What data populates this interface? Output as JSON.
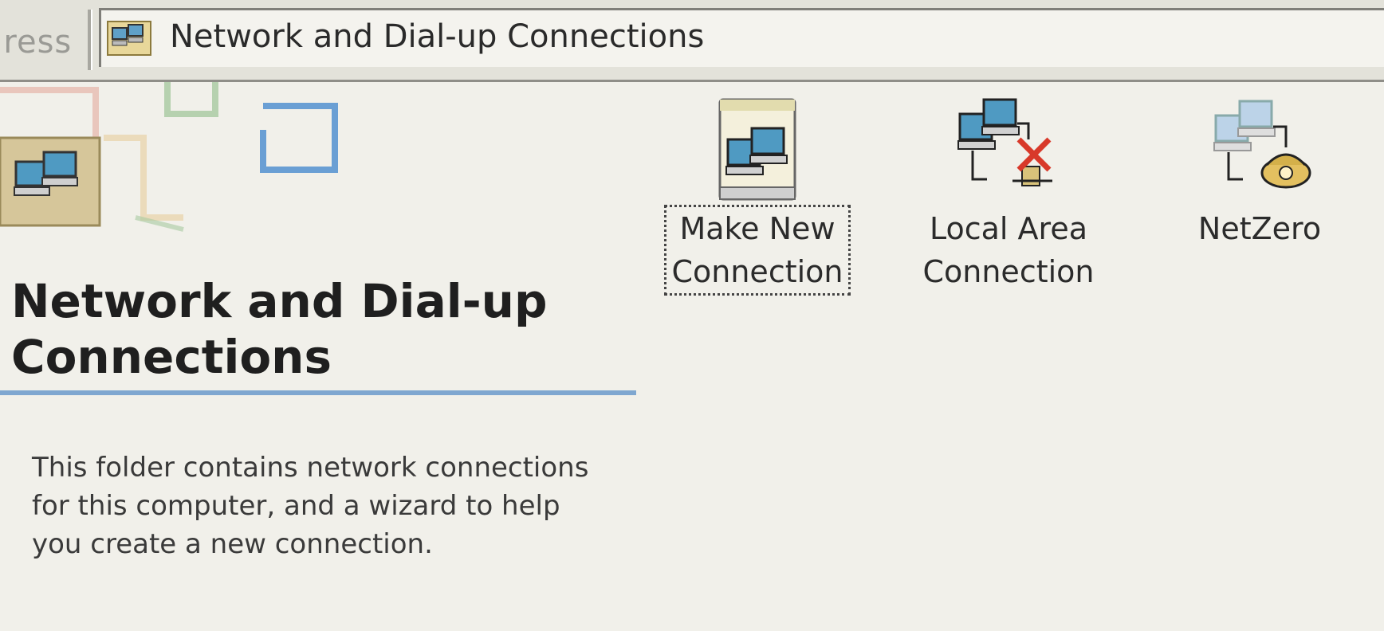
{
  "address_bar": {
    "label": "dress",
    "path": "Network and Dial-up Connections"
  },
  "left_panel": {
    "title": "Network and Dial-up Connections",
    "description": "This folder contains network connections for this computer, and a wizard to help you create a new connection."
  },
  "items": [
    {
      "label_line1": "Make New",
      "label_line2": "Connection",
      "icon": "make-new-connection-icon",
      "selected": true
    },
    {
      "label_line1": "Local Area",
      "label_line2": "Connection",
      "icon": "local-area-connection-disconnected-icon",
      "selected": false
    },
    {
      "label_line1": "NetZero",
      "label_line2": "",
      "icon": "dial-up-connection-icon",
      "selected": false
    }
  ],
  "colors": {
    "accent_rule": "#7fa7d0",
    "disconnected_x": "#d8392a",
    "background": "#f1f0ea"
  }
}
